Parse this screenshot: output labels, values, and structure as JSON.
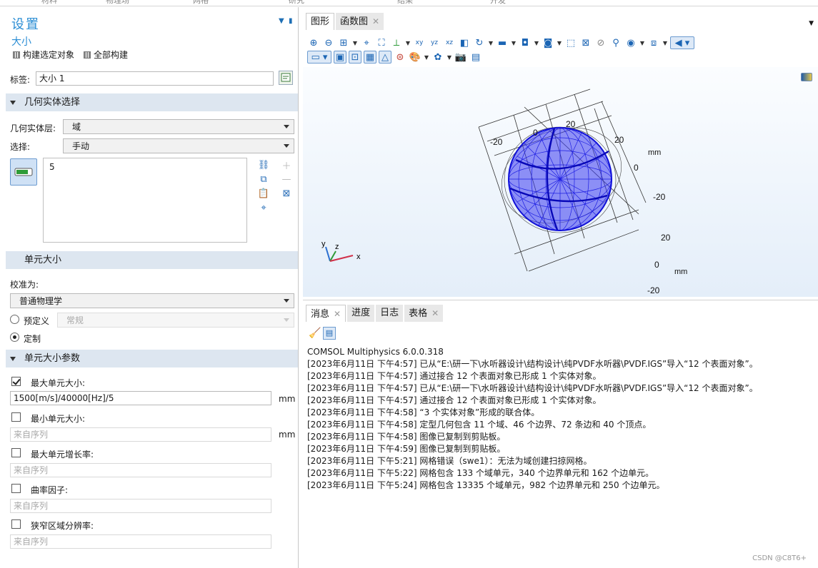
{
  "top_menu": [
    "材料",
    "物理场",
    "网格",
    "研究",
    "结果",
    "开发"
  ],
  "settings": {
    "title": "设置",
    "subtitle": "大小",
    "build_selected": "构建选定对象",
    "build_all": "全部构建",
    "label_caption": "标签:",
    "label_value": "大小 1"
  },
  "geometry_selection": {
    "header": "几何实体选择",
    "level_caption": "几何实体层:",
    "level_value": "域",
    "selection_caption": "选择:",
    "selection_value": "手动",
    "selected_item": "5"
  },
  "element_size": {
    "header": "单元大小",
    "calibrate_caption": "校准为:",
    "calibrate_value": "普通物理学",
    "predefined_label": "预定义",
    "predefined_value": "常规",
    "custom_label": "定制"
  },
  "element_size_params": {
    "header": "单元大小参数",
    "max_size_label": "最大单元大小:",
    "max_size_value": "1500[m/s]/40000[Hz]/5",
    "unit": "mm",
    "min_size_label": "最小单元大小:",
    "from_sequence": "来自序列",
    "max_growth_label": "最大单元增长率:",
    "curvature_label": "曲率因子:",
    "narrow_region_label": "狭窄区域分辨率:"
  },
  "graphics": {
    "tab_graphics": "图形",
    "tab_plots": "函数图",
    "axis_labels": {
      "top_neg": "-20",
      "top_zero": "0",
      "top_pos": "20",
      "top_unit": "mm",
      "right_a_pos": "20",
      "right_a_zero": "0",
      "right_a_neg": "-20",
      "right_b_pos": "20",
      "right_b_zero": "0",
      "right_b_unit": "mm",
      "right_b_neg": "-20"
    },
    "triad": {
      "x": "x",
      "y": "y",
      "z": "z"
    }
  },
  "messages": {
    "tabs": [
      "消息",
      "进度",
      "日志",
      "表格"
    ],
    "lines": [
      "COMSOL Multiphysics 6.0.0.318",
      "[2023年6月11日 下午4:57] 已从“E:\\研一下\\水听器设计\\结构设计\\纯PVDF水听器\\PVDF.IGS”导入“12 个表面对象”。",
      "[2023年6月11日 下午4:57] 通过接合 12 个表面对象已形成 1 个实体对象。",
      "[2023年6月11日 下午4:57] 已从“E:\\研一下\\水听器设计\\结构设计\\纯PVDF水听器\\PVDF.IGS”导入“12 个表面对象”。",
      "[2023年6月11日 下午4:57] 通过接合 12 个表面对象已形成 1 个实体对象。",
      "[2023年6月11日 下午4:58] “3 个实体对象”形成的联合体。",
      "[2023年6月11日 下午4:58] 定型几何包含 11 个域、46 个边界、72 条边和 40 个顶点。",
      "[2023年6月11日 下午4:58] 图像已复制到剪贴板。",
      "[2023年6月11日 下午4:59] 图像已复制到剪贴板。",
      "[2023年6月11日 下午5:21] 网格错误（swe1）：无法为域创建扫掠网格。",
      "[2023年6月11日 下午5:22] 网格包含 133 个域单元，340 个边界单元和 162 个边单元。",
      "[2023年6月11日 下午5:24] 网格包含 13335 个域单元，982 个边界单元和 250 个边单元。"
    ]
  },
  "watermark": "CSDN @C8T6+",
  "colors": {
    "accent": "#2a8dd4",
    "mesh": "#1515e6",
    "section_bg": "#dde6f0"
  }
}
